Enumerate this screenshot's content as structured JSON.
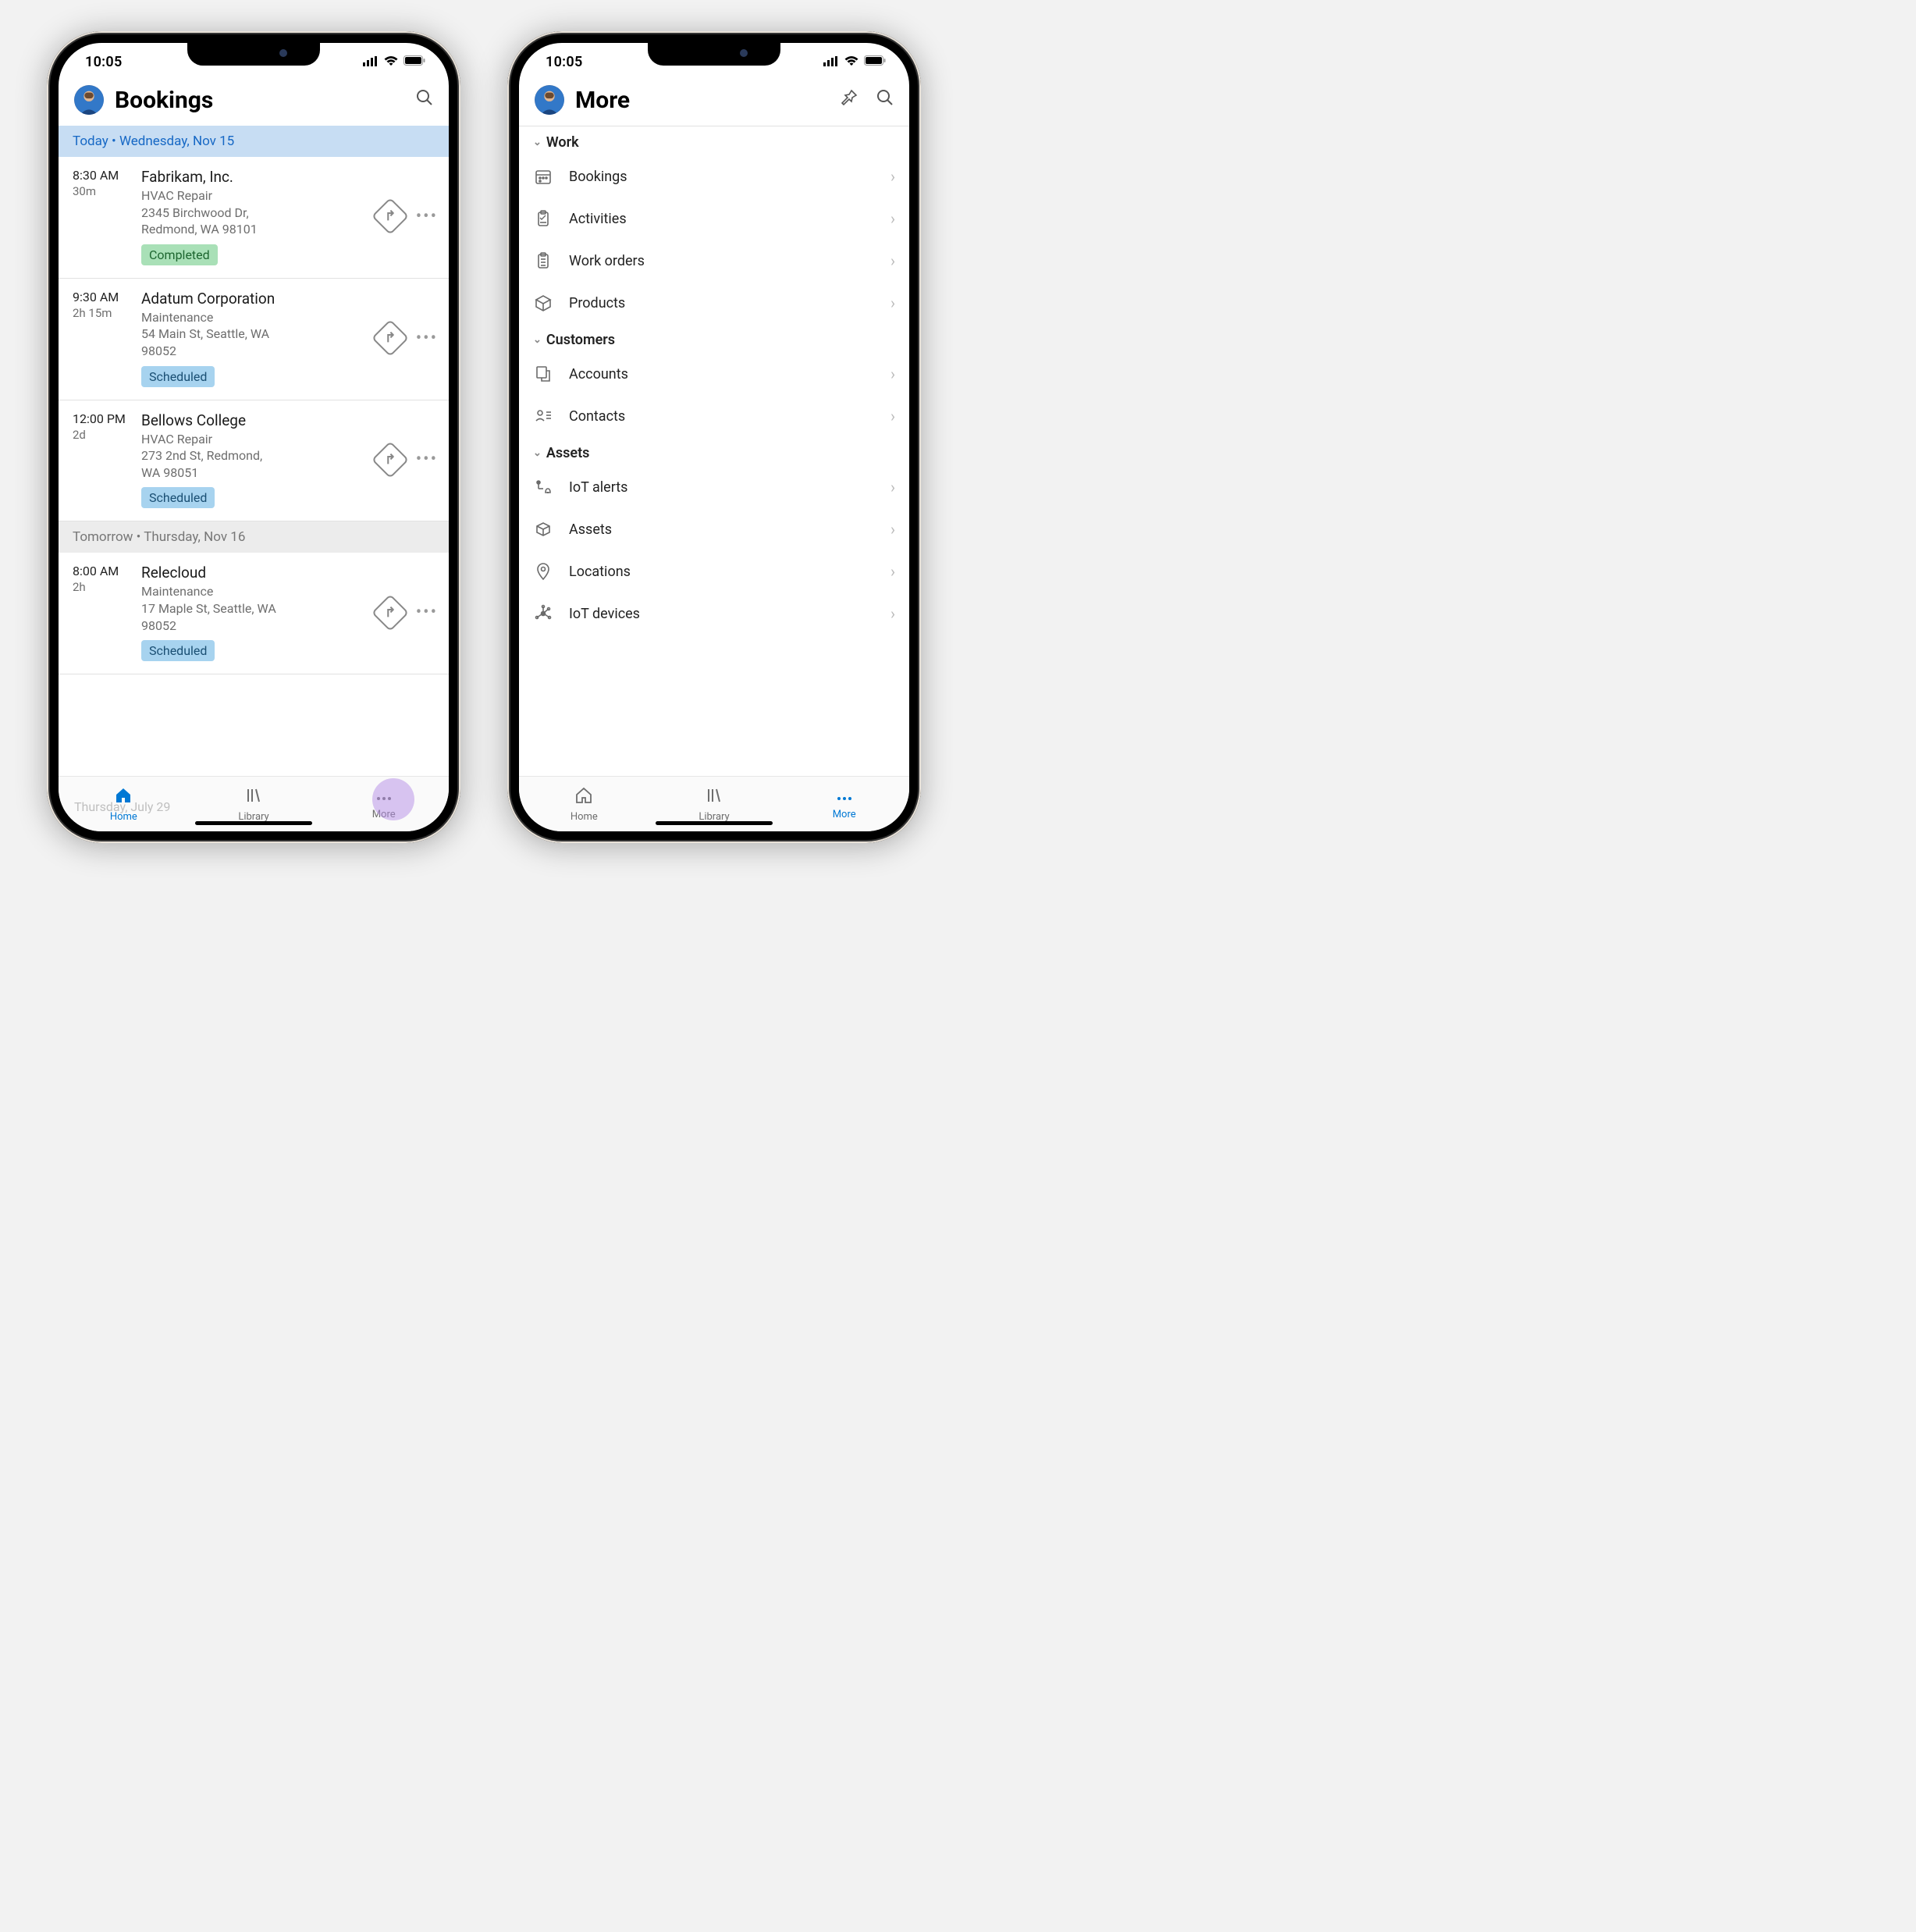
{
  "status": {
    "time": "10:05"
  },
  "phones": {
    "left": {
      "title": "Bookings",
      "sections": [
        {
          "label": "Today  •  Wednesday, Nov 15",
          "today": true,
          "items": [
            {
              "time": "8:30 AM",
              "dur": "30m",
              "company": "Fabrikam, Inc.",
              "type": "HVAC Repair",
              "addr1": "2345 Birchwood Dr,",
              "addr2": "Redmond, WA 98101",
              "status": "Completed",
              "statusClass": "completed"
            },
            {
              "time": "9:30 AM",
              "dur": "2h 15m",
              "company": "Adatum Corporation",
              "type": "Maintenance",
              "addr1": "54 Main St, Seattle, WA",
              "addr2": "98052",
              "status": "Scheduled",
              "statusClass": "scheduled"
            },
            {
              "time": "12:00 PM",
              "dur": "2d",
              "company": "Bellows College",
              "type": "HVAC Repair",
              "addr1": "273 2nd St, Redmond,",
              "addr2": "WA 98051",
              "status": "Scheduled",
              "statusClass": "scheduled"
            }
          ]
        },
        {
          "label": "Tomorrow  •  Thursday, Nov 16",
          "today": false,
          "items": [
            {
              "time": "8:00 AM",
              "dur": "2h",
              "company": "Relecloud",
              "type": "Maintenance",
              "addr1": "17 Maple St, Seattle, WA",
              "addr2": "98052",
              "status": "Scheduled",
              "statusClass": "scheduled"
            }
          ]
        }
      ],
      "ghost": "Thursday, July 29",
      "tabs": [
        {
          "label": "Home",
          "icon": "home",
          "active": true
        },
        {
          "label": "Library",
          "icon": "library",
          "active": false
        },
        {
          "label": "More",
          "icon": "more",
          "active": false,
          "highlight": true
        }
      ]
    },
    "right": {
      "title": "More",
      "groups": [
        {
          "label": "Work",
          "items": [
            {
              "label": "Bookings",
              "icon": "calendar"
            },
            {
              "label": "Activities",
              "icon": "clipboard-check"
            },
            {
              "label": "Work orders",
              "icon": "clipboard-list"
            },
            {
              "label": "Products",
              "icon": "box"
            }
          ]
        },
        {
          "label": "Customers",
          "items": [
            {
              "label": "Accounts",
              "icon": "account"
            },
            {
              "label": "Contacts",
              "icon": "contacts"
            }
          ]
        },
        {
          "label": "Assets",
          "items": [
            {
              "label": "IoT alerts",
              "icon": "iot-alert"
            },
            {
              "label": "Assets",
              "icon": "cube"
            },
            {
              "label": "Locations",
              "icon": "pin"
            },
            {
              "label": "IoT devices",
              "icon": "iot-device"
            }
          ]
        }
      ],
      "tabs": [
        {
          "label": "Home",
          "icon": "home",
          "active": false
        },
        {
          "label": "Library",
          "icon": "library",
          "active": false
        },
        {
          "label": "More",
          "icon": "more",
          "active": true
        }
      ]
    }
  }
}
